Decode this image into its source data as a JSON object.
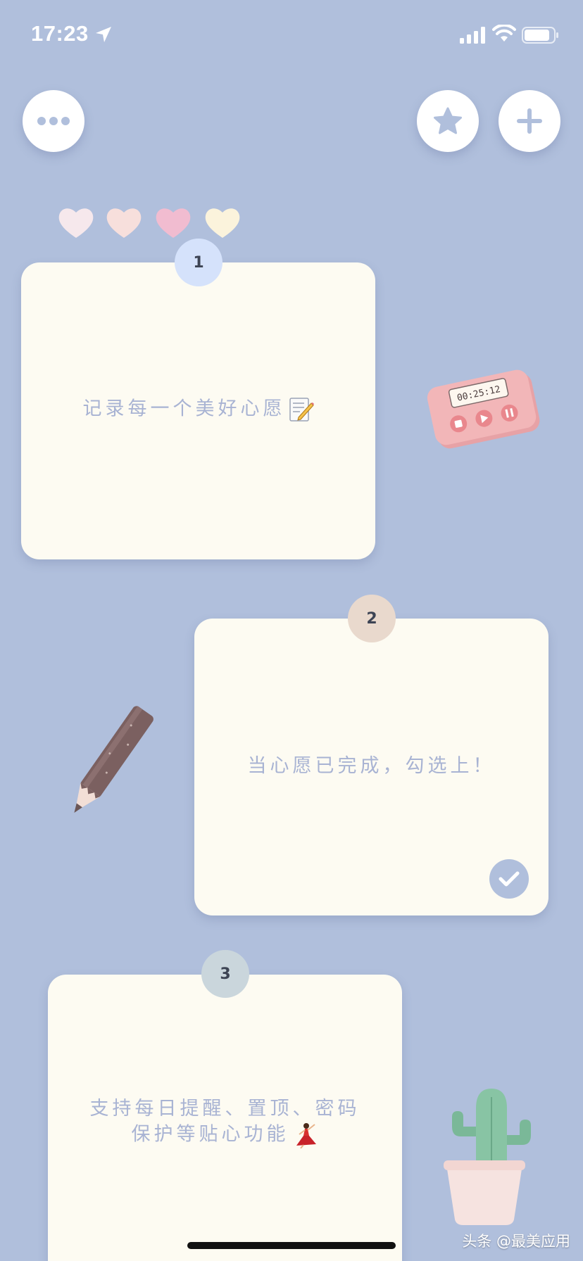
{
  "status_bar": {
    "time": "17:23"
  },
  "toolbar": {
    "more_icon": "ellipsis-icon",
    "favorites_icon": "star-icon",
    "add_icon": "plus-icon"
  },
  "cards": [
    {
      "number": "1",
      "text": "记录每一个美好心愿",
      "emoji": "memo-icon"
    },
    {
      "number": "2",
      "text": "当心愿已完成，勾选上！",
      "completed": true
    },
    {
      "number": "3",
      "text": "支持每日提醒、置顶、密码保护等贴心功能",
      "emoji": "dancer-icon"
    }
  ],
  "decorations": {
    "timer_display": "00:25:12"
  },
  "watermark": "头条 @最美应用",
  "colors": {
    "background": "#b0bfdc",
    "card": "#fdfbf2",
    "card_text": "#a8b3d3",
    "badge_1": "#d5e2fb",
    "badge_2": "#e9d9cd",
    "badge_3": "#cad6dc"
  }
}
